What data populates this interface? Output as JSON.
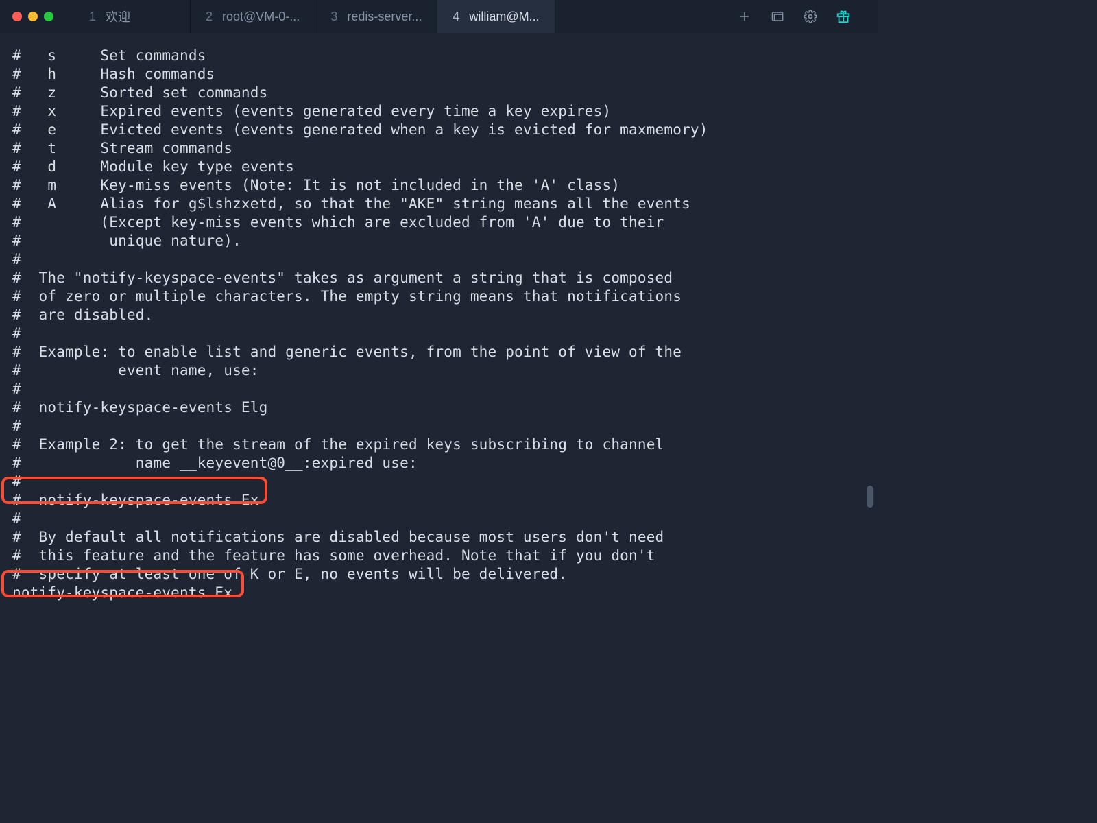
{
  "tabs": [
    {
      "index": "1",
      "label": "欢迎"
    },
    {
      "index": "2",
      "label": "root@VM-0-..."
    },
    {
      "index": "3",
      "label": "redis-server..."
    },
    {
      "index": "4",
      "label": "william@M..."
    }
  ],
  "editor_lines": [
    "#   s     Set commands",
    "#   h     Hash commands",
    "#   z     Sorted set commands",
    "#   x     Expired events (events generated every time a key expires)",
    "#   e     Evicted events (events generated when a key is evicted for maxmemory)",
    "#   t     Stream commands",
    "#   d     Module key type events",
    "#   m     Key-miss events (Note: It is not included in the 'A' class)",
    "#   A     Alias for g$lshzxetd, so that the \"AKE\" string means all the events",
    "#         (Except key-miss events which are excluded from 'A' due to their",
    "#          unique nature).",
    "#",
    "#  The \"notify-keyspace-events\" takes as argument a string that is composed",
    "#  of zero or multiple characters. The empty string means that notifications",
    "#  are disabled.",
    "#",
    "#  Example: to enable list and generic events, from the point of view of the",
    "#           event name, use:",
    "#",
    "#  notify-keyspace-events Elg",
    "#",
    "#  Example 2: to get the stream of the expired keys subscribing to channel",
    "#             name __keyevent@0__:expired use:",
    "#",
    "#  notify-keyspace-events Ex",
    "#",
    "#  By default all notifications are disabled because most users don't need",
    "#  this feature and the feature has some overhead. Note that if you don't",
    "#  specify at least one of K or E, no events will be delivered.",
    "notify-keyspace-events Ex"
  ]
}
